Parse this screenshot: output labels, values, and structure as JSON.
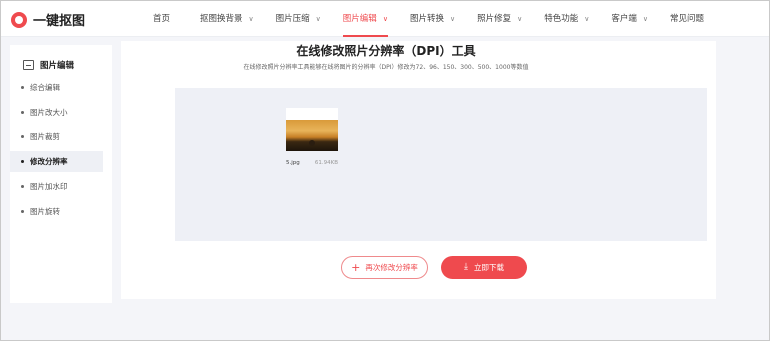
{
  "header": {
    "logo_text": "一键抠图",
    "nav": [
      {
        "label": "首页",
        "has_dropdown": false,
        "active": false
      },
      {
        "label": "抠图换背景",
        "has_dropdown": true,
        "active": false
      },
      {
        "label": "图片压缩",
        "has_dropdown": true,
        "active": false
      },
      {
        "label": "图片编辑",
        "has_dropdown": true,
        "active": true
      },
      {
        "label": "图片转换",
        "has_dropdown": true,
        "active": false
      },
      {
        "label": "照片修复",
        "has_dropdown": true,
        "active": false
      },
      {
        "label": "特色功能",
        "has_dropdown": true,
        "active": false
      },
      {
        "label": "客户端",
        "has_dropdown": true,
        "active": false
      },
      {
        "label": "常见问题",
        "has_dropdown": false,
        "active": false
      }
    ]
  },
  "sidebar": {
    "title": "图片编辑",
    "items": [
      {
        "label": "综合编辑",
        "active": false
      },
      {
        "label": "图片改大小",
        "active": false
      },
      {
        "label": "图片裁剪",
        "active": false
      },
      {
        "label": "修改分辨率",
        "active": true
      },
      {
        "label": "图片加水印",
        "active": false
      },
      {
        "label": "图片旋转",
        "active": false
      }
    ]
  },
  "main": {
    "title": "在线修改照片分辨率（DPI）工具",
    "subtitle": "在线修改照片分辨率工具能够在线将图片的分辨率（DPI）修改为72、96、150、300、500、1000等数值",
    "file": {
      "name": "5.jpg",
      "size": "61.94KB"
    },
    "buttons": {
      "again_label": "再次修改分辨率",
      "download_label": "立即下载"
    }
  },
  "colors": {
    "accent": "#ef4a4e",
    "background": "#f4f5f9",
    "upload_area": "#eef0f6"
  }
}
